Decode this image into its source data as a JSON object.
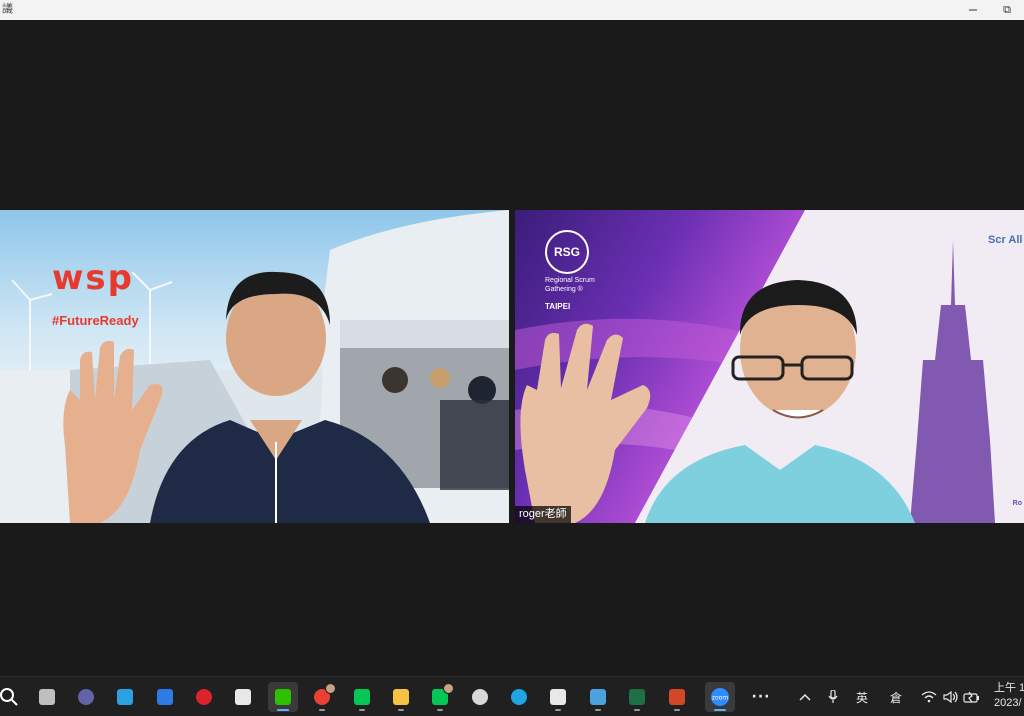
{
  "window": {
    "app_glyph": "議",
    "restore_glyph": "⧉"
  },
  "participants": [
    {
      "background_logo": "wsp",
      "background_tagline": "#FutureReady",
      "name_label": ""
    },
    {
      "background_badge": "RSG",
      "background_subtitle": "Regional Scrum Gathering ®",
      "background_city": "TAIPEI",
      "background_partner": "Scr All",
      "name_label": "roger老師",
      "corner_text": "Ro"
    }
  ],
  "taskbar": {
    "apps": [
      {
        "name": "search-icon",
        "color": "#ffffff"
      },
      {
        "name": "task-view-icon",
        "color": "#bfbfbf"
      },
      {
        "name": "meeting-app-icon",
        "color": "#6264a7"
      },
      {
        "name": "desktop-icon",
        "color": "#2aa1e0"
      },
      {
        "name": "screen-capture-icon",
        "color": "#2d7be5"
      },
      {
        "name": "antivirus-icon",
        "color": "#d9232d"
      },
      {
        "name": "microsoft-store-icon",
        "color": "#e8e8e8"
      },
      {
        "name": "wechat-icon",
        "color": "#2dc100"
      },
      {
        "name": "chrome-icon",
        "color": "#e94235"
      },
      {
        "name": "line-icon",
        "color": "#06c755"
      },
      {
        "name": "file-explorer-icon",
        "color": "#f5c242"
      },
      {
        "name": "line-icon-2",
        "color": "#06c755"
      },
      {
        "name": "clock-app-icon",
        "color": "#d8d8d8"
      },
      {
        "name": "edge-icon",
        "color": "#1fa6e0"
      },
      {
        "name": "snipping-tool-icon",
        "color": "#e8e8e8"
      },
      {
        "name": "notepad-icon",
        "color": "#4aa3df"
      },
      {
        "name": "excel-icon",
        "color": "#1d7044"
      },
      {
        "name": "powerpoint-icon",
        "color": "#d24726"
      },
      {
        "name": "zoom-icon",
        "color": "#2d8cff"
      }
    ],
    "zoom_label": "zoom",
    "more_label": "···"
  },
  "tray": {
    "chevron": "^",
    "ime_label": "英",
    "ime_mode": "倉",
    "clock_line1": "上午 1",
    "clock_line2": "2023/"
  }
}
